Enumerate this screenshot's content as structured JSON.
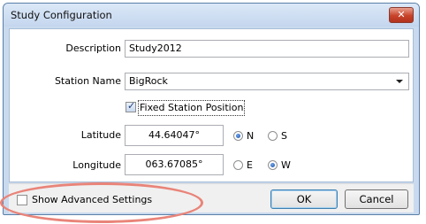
{
  "window": {
    "title": "Study Configuration",
    "close_label": "✕"
  },
  "form": {
    "description": {
      "label": "Description",
      "value": "Study2012"
    },
    "station": {
      "label": "Station Name",
      "value": "BigRock"
    },
    "fixed_position": {
      "label": "Fixed Station Position",
      "checked": true
    },
    "latitude": {
      "label": "Latitude",
      "value": "44.64047°",
      "options": [
        "N",
        "S"
      ],
      "selected": "N"
    },
    "longitude": {
      "label": "Longitude",
      "value": "063.67085°",
      "options": [
        "E",
        "W"
      ],
      "selected": "W"
    }
  },
  "footer": {
    "advanced": {
      "label": "Show Advanced Settings",
      "checked": false
    },
    "ok_label": "OK",
    "cancel_label": "Cancel"
  },
  "colors": {
    "highlight": "#e98479",
    "dialog_frame": "#c9daef",
    "close_button": "#c8432a"
  }
}
